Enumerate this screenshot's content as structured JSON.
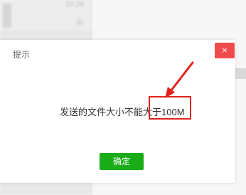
{
  "background": {
    "time_label": "17:29",
    "mute_icon": "bell-mute-icon"
  },
  "dialog": {
    "title": "提示",
    "close_label": "×",
    "message": "发送的文件大小不能大于100M",
    "confirm_label": "确定"
  },
  "colors": {
    "close_button": "#f04b4b",
    "confirm_button": "#1aad19",
    "annotation": "#e0221d"
  }
}
